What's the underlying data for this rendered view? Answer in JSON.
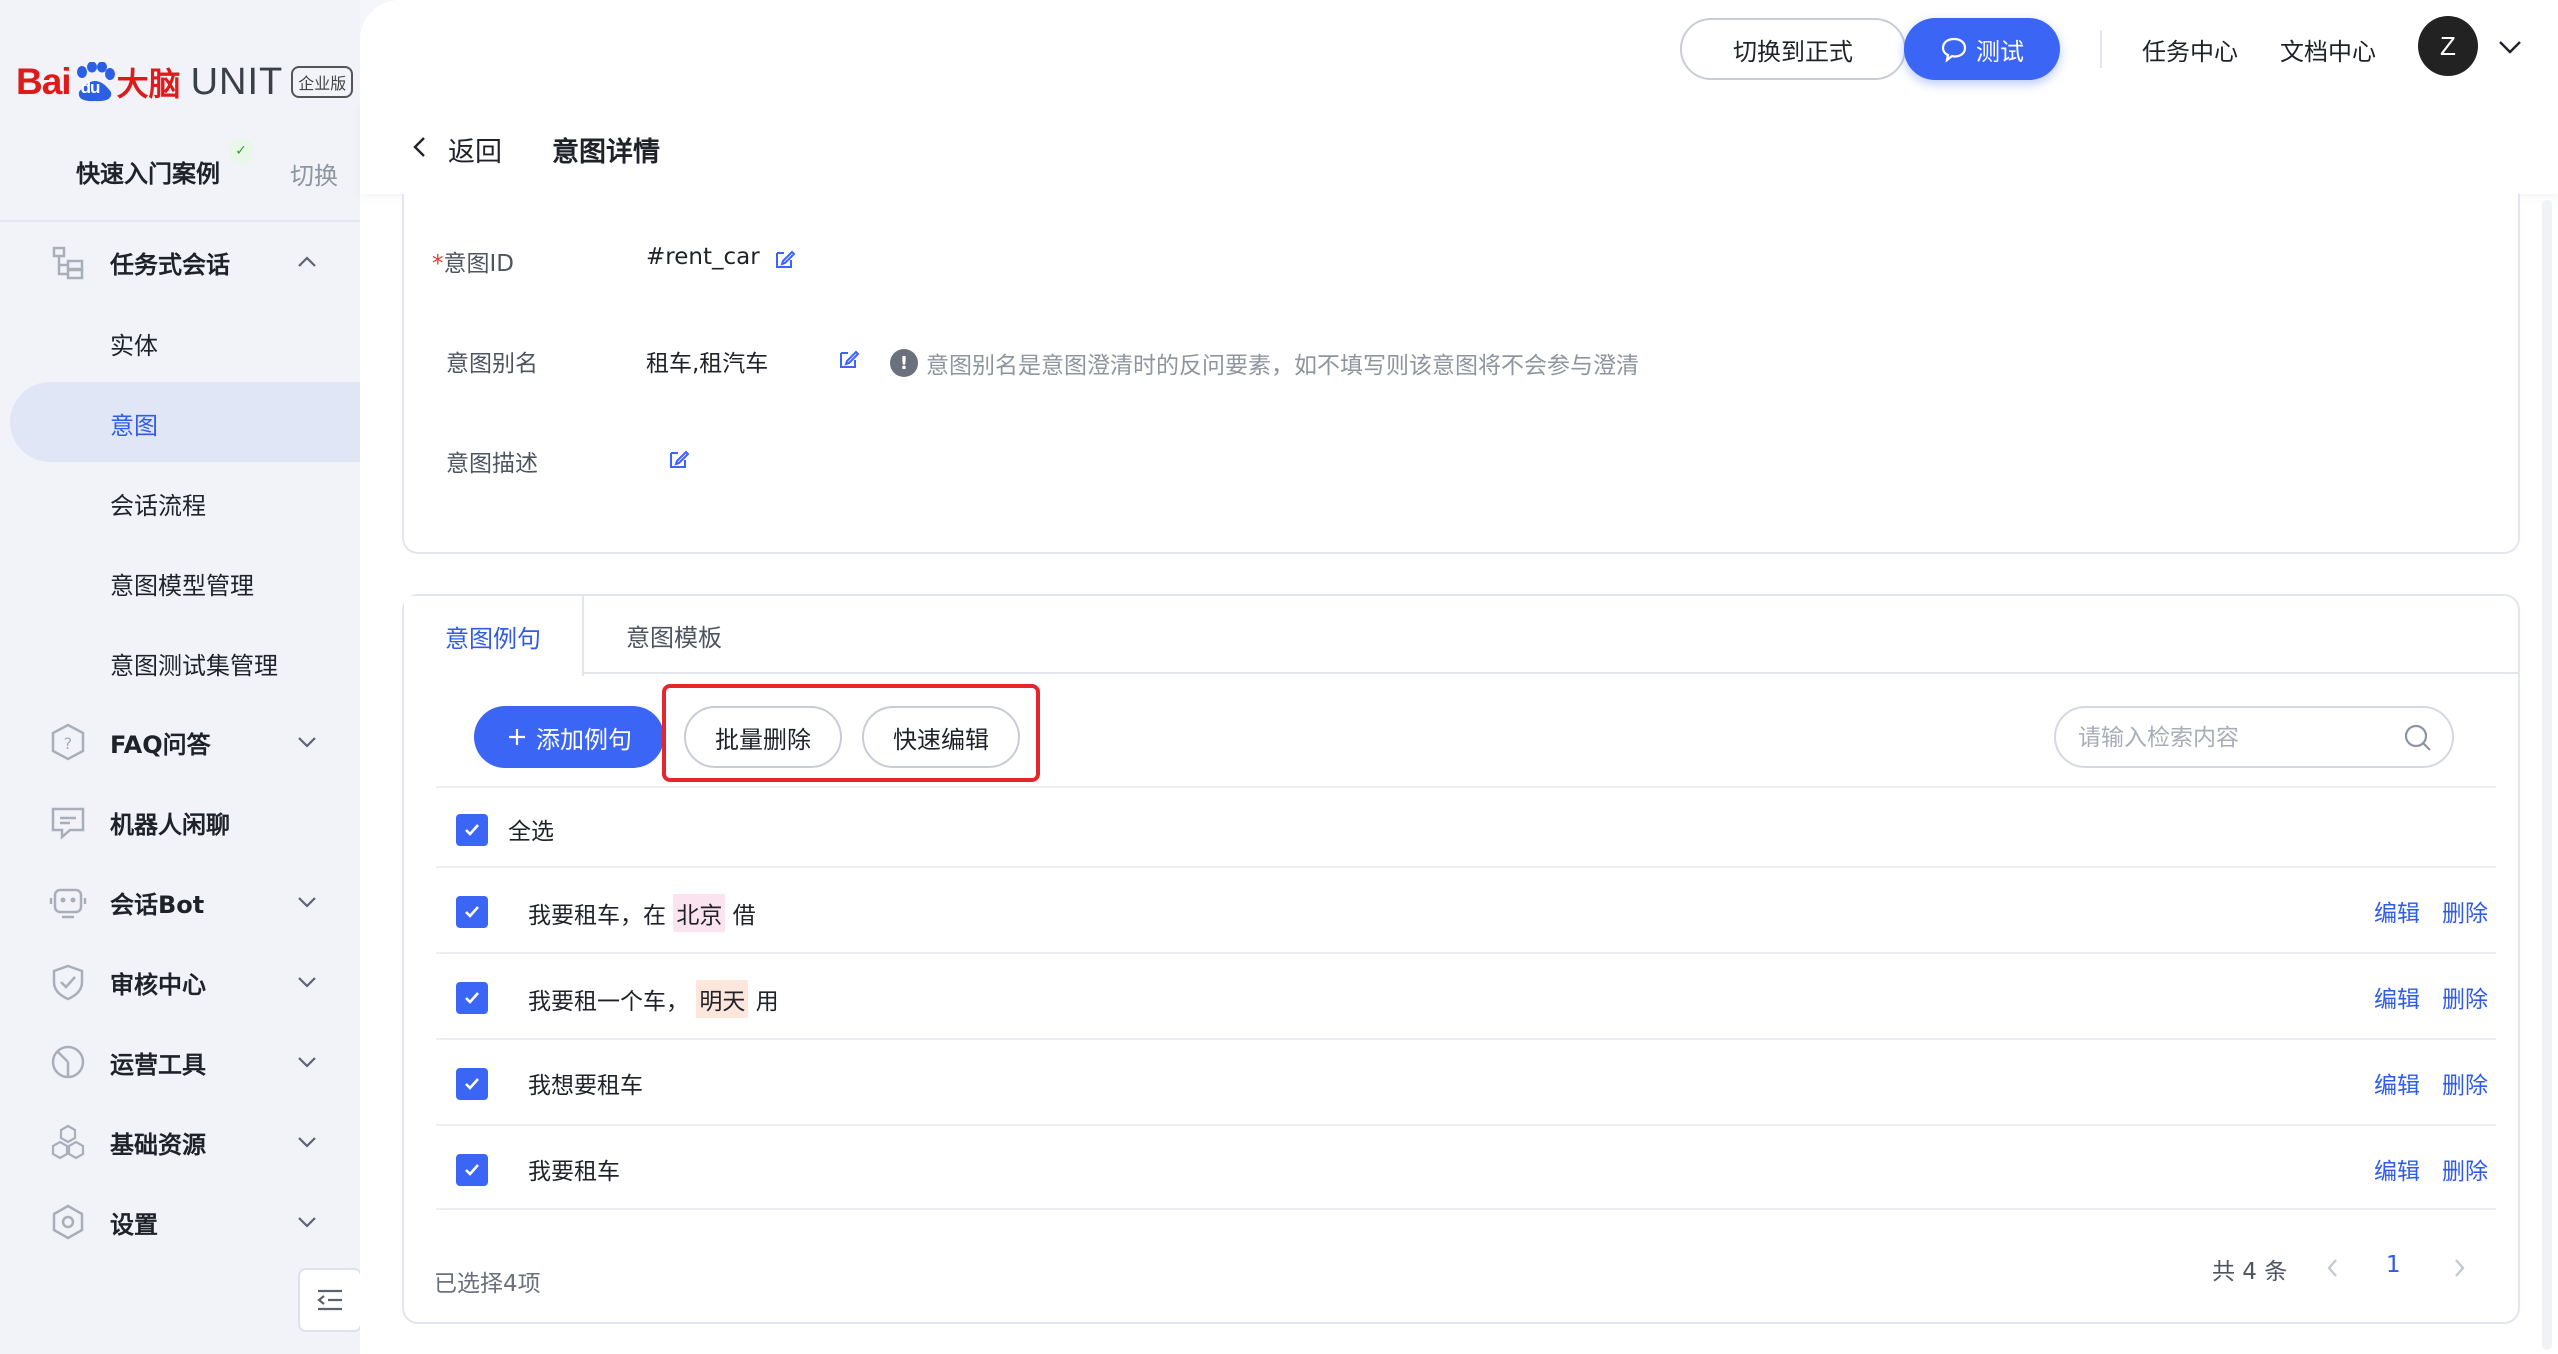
{
  "brand": {
    "baidu": "Bai",
    "du": "du",
    "dana": "大脑",
    "unit": "UNIT",
    "edition": "企业版"
  },
  "sidebar": {
    "case_name": "快速入门案例",
    "case_switch": "切换",
    "menu": [
      {
        "label": "任务式会话",
        "icon": "task-dialog-icon"
      },
      {
        "label": "FAQ问答",
        "icon": "faq-icon"
      },
      {
        "label": "机器人闲聊",
        "icon": "chat-icon"
      },
      {
        "label": "会话Bot",
        "icon": "bot-icon"
      },
      {
        "label": "审核中心",
        "icon": "shield-icon"
      },
      {
        "label": "运营工具",
        "icon": "ops-icon"
      },
      {
        "label": "基础资源",
        "icon": "resource-icon"
      },
      {
        "label": "设置",
        "icon": "gear-icon"
      }
    ],
    "sub_items": [
      "实体",
      "意图",
      "会话流程",
      "意图模型管理",
      "意图测试集管理"
    ],
    "active_sub": "意图"
  },
  "topbar": {
    "switch_formal": "切换到正式",
    "test": "测试",
    "task_center": "任务中心",
    "doc_center": "文档中心",
    "avatar_letter": "Z"
  },
  "header": {
    "back": "返回",
    "title": "意图详情"
  },
  "intent": {
    "id_label": "意图ID",
    "id_required": "*",
    "id_value": "#rent_car",
    "alias_label": "意图别名",
    "alias_value": "租车,租汽车",
    "alias_hint": "意图别名是意图澄清时的反问要素，如不填写则该意图将不会参与澄清",
    "desc_label": "意图描述",
    "desc_value": ""
  },
  "tabs": {
    "examples": "意图例句",
    "templates": "意图模板"
  },
  "toolbar": {
    "add": "添加例句",
    "batch_delete": "批量删除",
    "quick_edit": "快速编辑",
    "search_placeholder": "请输入检索内容"
  },
  "table": {
    "select_all": "全选",
    "rows": [
      {
        "pre": "我要租车，在 ",
        "tag": "北京",
        "tag_type": "city",
        "post": " 借"
      },
      {
        "pre": "我要租一个车， ",
        "tag": "明天",
        "tag_type": "time",
        "post": " 用"
      },
      {
        "pre": "我想要租车",
        "tag": "",
        "tag_type": "",
        "post": ""
      },
      {
        "pre": "我要租车",
        "tag": "",
        "tag_type": "",
        "post": ""
      }
    ],
    "edit": "编辑",
    "delete": "删除"
  },
  "footer": {
    "selected": "已选择4项",
    "total": "共 4 条",
    "page": "1"
  },
  "colors": {
    "primary": "#3b66f5",
    "brand_red": "#de1b1b",
    "highlight_red": "#e5262d",
    "city_tag": "#fbe3ef",
    "time_tag": "#fde6db"
  }
}
